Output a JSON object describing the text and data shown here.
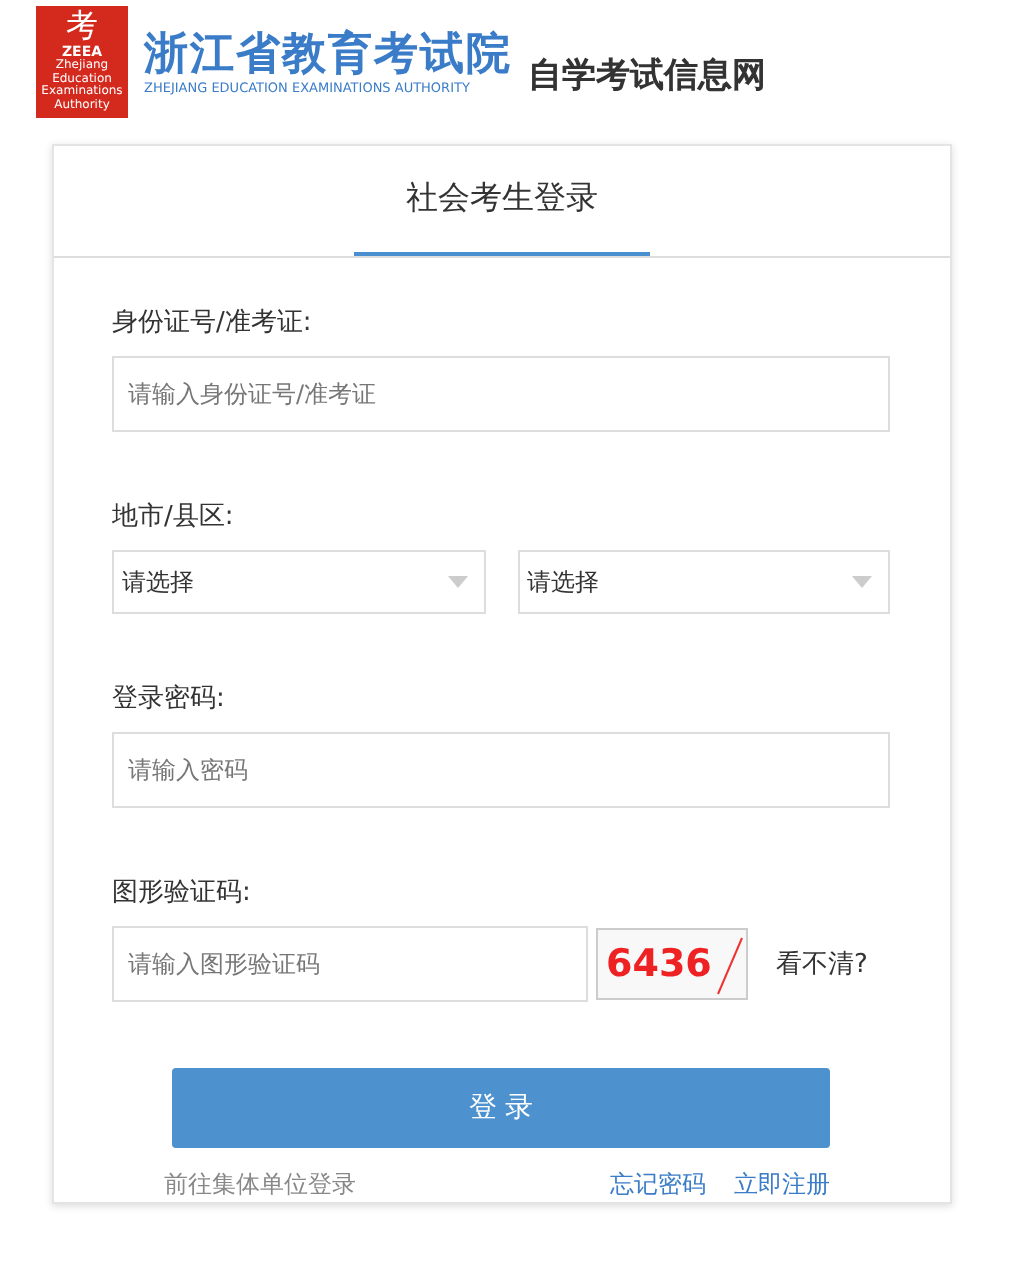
{
  "header": {
    "logo": {
      "glyph": "考",
      "abbr": "ZEEA",
      "line_1": "Zhejiang Education",
      "line_2": "Examinations Authority"
    },
    "title": "浙江省教育考试院",
    "subtitle": "ZHEJIANG EDUCATION EXAMINATIONS AUTHORITY",
    "site_name": "自学考试信息网"
  },
  "tabs": [
    {
      "label": "社会考生登录",
      "selected": true
    }
  ],
  "form": {
    "id_label": "身份证号/准考证:",
    "id_placeholder": "请输入身份证号/准考证",
    "region_label": "地市/县区:",
    "selects": [
      {
        "value": "请选择"
      },
      {
        "value": "请选择"
      }
    ],
    "password_label": "登录密码:",
    "password_placeholder": "请输入密码",
    "captcha_label": "图形验证码:",
    "captcha_placeholder": "请输入图形验证码",
    "captcha_text": "6436",
    "refresh_link": "看不清?"
  },
  "login_button": "登 录",
  "links": {
    "group_login": "前往集体单位登录",
    "forgot_password": "忘记密码",
    "register": "立即注册"
  }
}
